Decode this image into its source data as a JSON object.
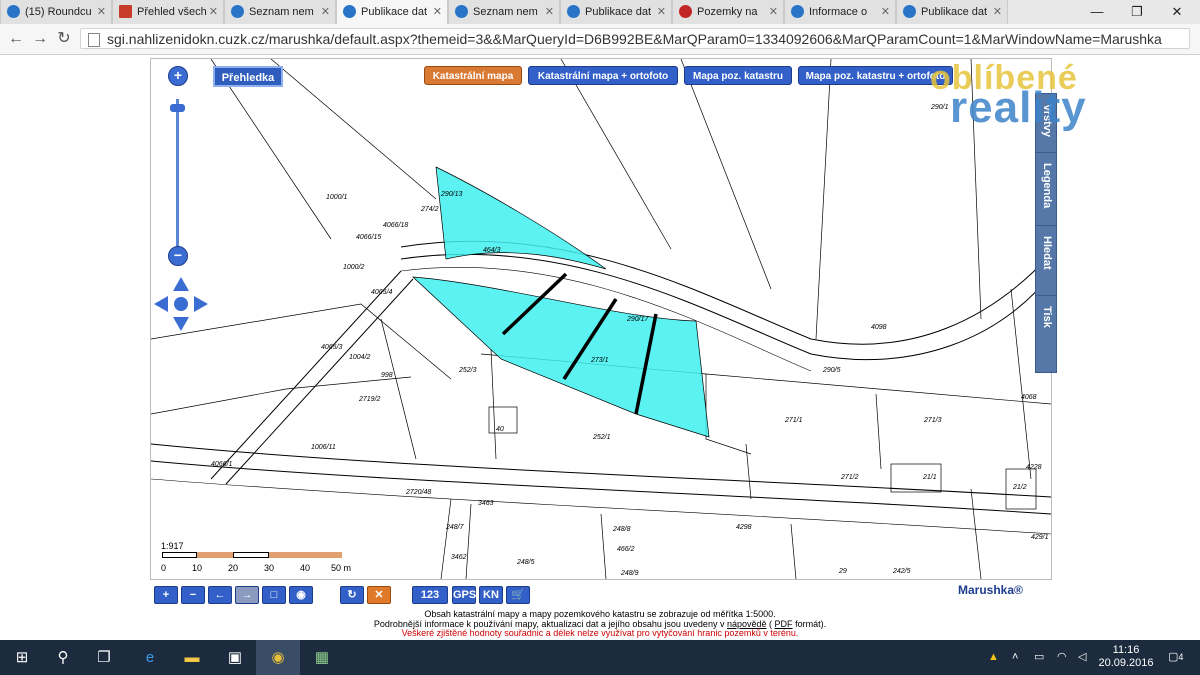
{
  "browser": {
    "tabs": [
      {
        "label": "(15) Roundcu",
        "icon": "roundcube-icon",
        "active": false
      },
      {
        "label": "Přehled všech",
        "icon": "document-icon",
        "active": false
      },
      {
        "label": "Seznam nem",
        "icon": "cuzk-icon",
        "active": false
      },
      {
        "label": "Publikace dat",
        "icon": "cuzk-icon",
        "active": true
      },
      {
        "label": "Seznam nem",
        "icon": "cuzk-icon",
        "active": false
      },
      {
        "label": "Publikace dat",
        "icon": "cuzk-icon",
        "active": false
      },
      {
        "label": "Pozemky na",
        "icon": "red-icon",
        "active": false
      },
      {
        "label": "Informace o",
        "icon": "cuzk-icon",
        "active": false
      },
      {
        "label": "Publikace dat",
        "icon": "cuzk-icon",
        "active": false
      }
    ],
    "url": "sgi.nahlizenidokn.cuzk.cz/marushka/default.aspx?themeid=3&&MarQueryId=D6B992BE&MarQParam0=1334092606&MarQParamCount=1&MarWindowName=Marushka"
  },
  "map": {
    "overview_button": "Přehledka",
    "layers": [
      {
        "label": "Katastrální mapa",
        "active": true
      },
      {
        "label": "Katastrální mapa + ortofoto",
        "active": false
      },
      {
        "label": "Mapa poz. katastru",
        "active": false
      },
      {
        "label": "Mapa poz. katastru + ortofoto",
        "active": false
      }
    ],
    "side_tabs": [
      "Vrstvy",
      "Legenda",
      "Hledat",
      "Tisk"
    ],
    "scale": {
      "ratio": "1:917",
      "ticks": [
        "0",
        "10",
        "20",
        "30",
        "40",
        "50 m"
      ]
    },
    "parcels": [
      "290/13",
      "274/2",
      "1000/1",
      "4066/18",
      "4066/15",
      "1000/2",
      "464/3",
      "4065/4",
      "290/17",
      "273/1",
      "252/3",
      "1004/2",
      "998",
      "2719/2",
      "1006/11",
      "40",
      "252/1",
      "4066/1",
      "2720/48",
      "248/8",
      "248/7",
      "3463",
      "248/5",
      "466/2",
      "248/9",
      "290/5",
      "271/1",
      "271/3",
      "271/2",
      "21/1",
      "21/2",
      "429/1",
      "29",
      "242/5",
      "4298",
      "4228",
      "290/1",
      "4098",
      "3462",
      "4065/3",
      "4068"
    ],
    "vendor": "Marushka®",
    "notes": [
      "Obsah katastrální mapy a mapy pozemkového katastru se zobrazuje od měřítka 1:5000.",
      "Podrobnější informace k používání mapy, aktualizaci dat a jejího obsahu jsou uvedeny v",
      "nápovědě",
      "(",
      "PDF",
      "formát).",
      "Veškeré zjištěné hodnoty souřadnic a délek nelze využívat pro vytyčování hranic pozemků v terénu."
    ],
    "toolbar": [
      "+",
      "−",
      "←",
      "→",
      "□",
      "◉",
      "↻",
      "✕",
      "123",
      "GPS",
      "KN",
      "🛒"
    ]
  },
  "watermark": {
    "line1": "oblíbené",
    "line2": "reality"
  },
  "taskbar": {
    "time": "11:16",
    "date": "20.09.2016",
    "notifications": "4"
  }
}
